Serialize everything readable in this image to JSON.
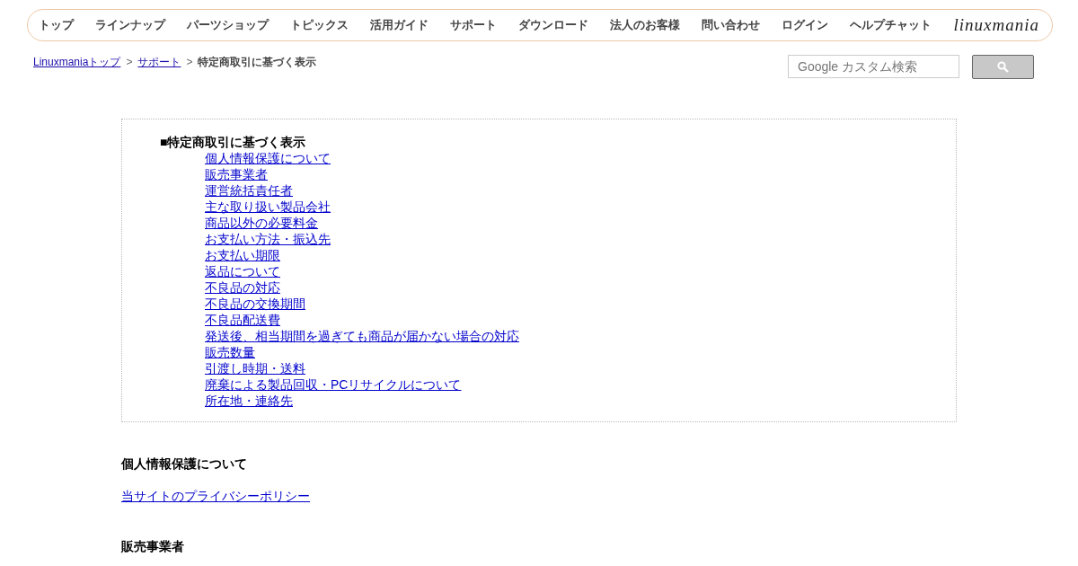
{
  "nav": {
    "items": [
      "トップ",
      "ラインナップ",
      "パーツショップ",
      "トピックス",
      "活用ガイド",
      "サポート",
      "ダウンロード",
      "法人のお客様",
      "問い合わせ",
      "ログイン",
      "ヘルプチャット"
    ],
    "logo": "linuxmania"
  },
  "breadcrumb": {
    "links": [
      "Linuxmaniaトップ",
      "サポート"
    ],
    "separators": [
      ">",
      ">"
    ],
    "current": "特定商取引に基づく表示"
  },
  "search": {
    "placeholder": "Google カスタム検索"
  },
  "toc": {
    "title": "■特定商取引に基づく表示",
    "links": [
      "個人情報保護について",
      "販売事業者",
      "運営統括責任者",
      "主な取り扱い製品会社",
      "商品以外の必要料金",
      "お支払い方法・振込先",
      "お支払い期限",
      "返品について",
      "不良品の対応",
      "不良品の交換期間",
      "不良品配送費",
      "発送後、相当期間を過ぎても商品が届かない場合の対応",
      "販売数量",
      "引渡し時期・送料",
      "廃棄による製品回収・PCリサイクルについて",
      "所在地・連絡先"
    ]
  },
  "sections": [
    {
      "heading": "個人情報保護について",
      "link": "当サイトのプライバシーポリシー"
    },
    {
      "heading": "販売事業者"
    }
  ]
}
